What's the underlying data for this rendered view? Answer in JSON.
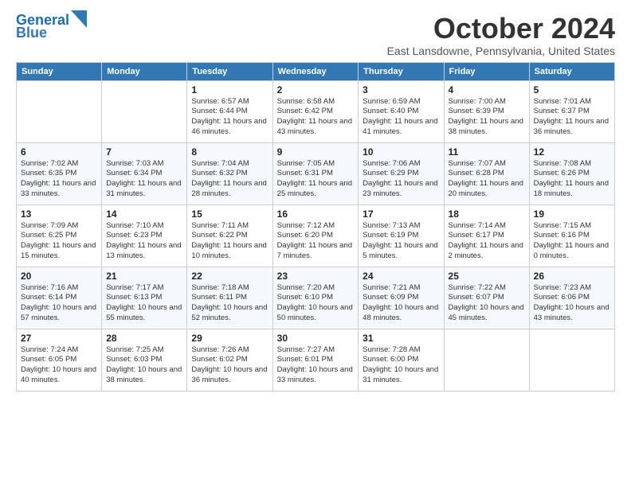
{
  "logo": {
    "line1": "General",
    "line2": "Blue"
  },
  "header": {
    "month": "October 2024",
    "location": "East Lansdowne, Pennsylvania, United States"
  },
  "weekdays": [
    "Sunday",
    "Monday",
    "Tuesday",
    "Wednesday",
    "Thursday",
    "Friday",
    "Saturday"
  ],
  "weeks": [
    [
      {
        "day": "",
        "info": ""
      },
      {
        "day": "",
        "info": ""
      },
      {
        "day": "1",
        "info": "Sunrise: 6:57 AM\nSunset: 6:44 PM\nDaylight: 11 hours and 46 minutes."
      },
      {
        "day": "2",
        "info": "Sunrise: 6:58 AM\nSunset: 6:42 PM\nDaylight: 11 hours and 43 minutes."
      },
      {
        "day": "3",
        "info": "Sunrise: 6:59 AM\nSunset: 6:40 PM\nDaylight: 11 hours and 41 minutes."
      },
      {
        "day": "4",
        "info": "Sunrise: 7:00 AM\nSunset: 6:39 PM\nDaylight: 11 hours and 38 minutes."
      },
      {
        "day": "5",
        "info": "Sunrise: 7:01 AM\nSunset: 6:37 PM\nDaylight: 11 hours and 36 minutes."
      }
    ],
    [
      {
        "day": "6",
        "info": "Sunrise: 7:02 AM\nSunset: 6:35 PM\nDaylight: 11 hours and 33 minutes."
      },
      {
        "day": "7",
        "info": "Sunrise: 7:03 AM\nSunset: 6:34 PM\nDaylight: 11 hours and 31 minutes."
      },
      {
        "day": "8",
        "info": "Sunrise: 7:04 AM\nSunset: 6:32 PM\nDaylight: 11 hours and 28 minutes."
      },
      {
        "day": "9",
        "info": "Sunrise: 7:05 AM\nSunset: 6:31 PM\nDaylight: 11 hours and 25 minutes."
      },
      {
        "day": "10",
        "info": "Sunrise: 7:06 AM\nSunset: 6:29 PM\nDaylight: 11 hours and 23 minutes."
      },
      {
        "day": "11",
        "info": "Sunrise: 7:07 AM\nSunset: 6:28 PM\nDaylight: 11 hours and 20 minutes."
      },
      {
        "day": "12",
        "info": "Sunrise: 7:08 AM\nSunset: 6:26 PM\nDaylight: 11 hours and 18 minutes."
      }
    ],
    [
      {
        "day": "13",
        "info": "Sunrise: 7:09 AM\nSunset: 6:25 PM\nDaylight: 11 hours and 15 minutes."
      },
      {
        "day": "14",
        "info": "Sunrise: 7:10 AM\nSunset: 6:23 PM\nDaylight: 11 hours and 13 minutes."
      },
      {
        "day": "15",
        "info": "Sunrise: 7:11 AM\nSunset: 6:22 PM\nDaylight: 11 hours and 10 minutes."
      },
      {
        "day": "16",
        "info": "Sunrise: 7:12 AM\nSunset: 6:20 PM\nDaylight: 11 hours and 7 minutes."
      },
      {
        "day": "17",
        "info": "Sunrise: 7:13 AM\nSunset: 6:19 PM\nDaylight: 11 hours and 5 minutes."
      },
      {
        "day": "18",
        "info": "Sunrise: 7:14 AM\nSunset: 6:17 PM\nDaylight: 11 hours and 2 minutes."
      },
      {
        "day": "19",
        "info": "Sunrise: 7:15 AM\nSunset: 6:16 PM\nDaylight: 11 hours and 0 minutes."
      }
    ],
    [
      {
        "day": "20",
        "info": "Sunrise: 7:16 AM\nSunset: 6:14 PM\nDaylight: 10 hours and 57 minutes."
      },
      {
        "day": "21",
        "info": "Sunrise: 7:17 AM\nSunset: 6:13 PM\nDaylight: 10 hours and 55 minutes."
      },
      {
        "day": "22",
        "info": "Sunrise: 7:18 AM\nSunset: 6:11 PM\nDaylight: 10 hours and 52 minutes."
      },
      {
        "day": "23",
        "info": "Sunrise: 7:20 AM\nSunset: 6:10 PM\nDaylight: 10 hours and 50 minutes."
      },
      {
        "day": "24",
        "info": "Sunrise: 7:21 AM\nSunset: 6:09 PM\nDaylight: 10 hours and 48 minutes."
      },
      {
        "day": "25",
        "info": "Sunrise: 7:22 AM\nSunset: 6:07 PM\nDaylight: 10 hours and 45 minutes."
      },
      {
        "day": "26",
        "info": "Sunrise: 7:23 AM\nSunset: 6:06 PM\nDaylight: 10 hours and 43 minutes."
      }
    ],
    [
      {
        "day": "27",
        "info": "Sunrise: 7:24 AM\nSunset: 6:05 PM\nDaylight: 10 hours and 40 minutes."
      },
      {
        "day": "28",
        "info": "Sunrise: 7:25 AM\nSunset: 6:03 PM\nDaylight: 10 hours and 38 minutes."
      },
      {
        "day": "29",
        "info": "Sunrise: 7:26 AM\nSunset: 6:02 PM\nDaylight: 10 hours and 36 minutes."
      },
      {
        "day": "30",
        "info": "Sunrise: 7:27 AM\nSunset: 6:01 PM\nDaylight: 10 hours and 33 minutes."
      },
      {
        "day": "31",
        "info": "Sunrise: 7:28 AM\nSunset: 6:00 PM\nDaylight: 10 hours and 31 minutes."
      },
      {
        "day": "",
        "info": ""
      },
      {
        "day": "",
        "info": ""
      }
    ]
  ]
}
